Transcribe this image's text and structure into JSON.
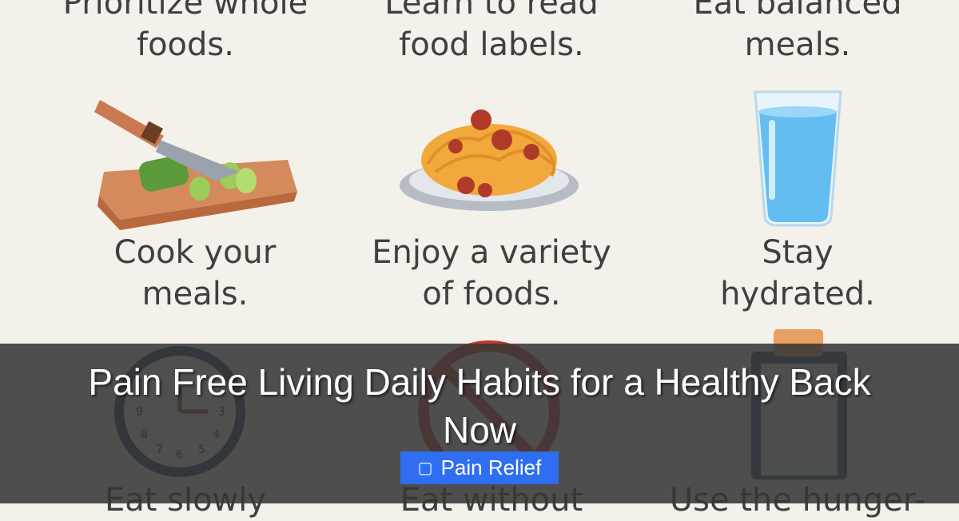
{
  "tiles": {
    "top_row": [
      {
        "line1": "Prioritize whole",
        "line2": "foods."
      },
      {
        "line1": "Learn to read",
        "line2": "food labels."
      },
      {
        "line1": "Eat balanced",
        "line2": "meals."
      }
    ],
    "middle_row": [
      {
        "line1": "Cook your",
        "line2": "meals."
      },
      {
        "line1": "Enjoy a variety",
        "line2": "of foods."
      },
      {
        "line1": "Stay",
        "line2": "hydrated."
      }
    ],
    "bottom_row": [
      {
        "line1": "Eat slowly"
      },
      {
        "line1": "Eat without"
      },
      {
        "line1": "Use the hunger-"
      }
    ]
  },
  "overlay": {
    "title": "Pain Free Living Daily Habits for a Healthy Back Now",
    "category_icon": "tag-icon",
    "category_label": "Pain Relief"
  },
  "clock_numbers": [
    "9",
    "3",
    "8",
    "4",
    "7",
    "6",
    "5"
  ]
}
